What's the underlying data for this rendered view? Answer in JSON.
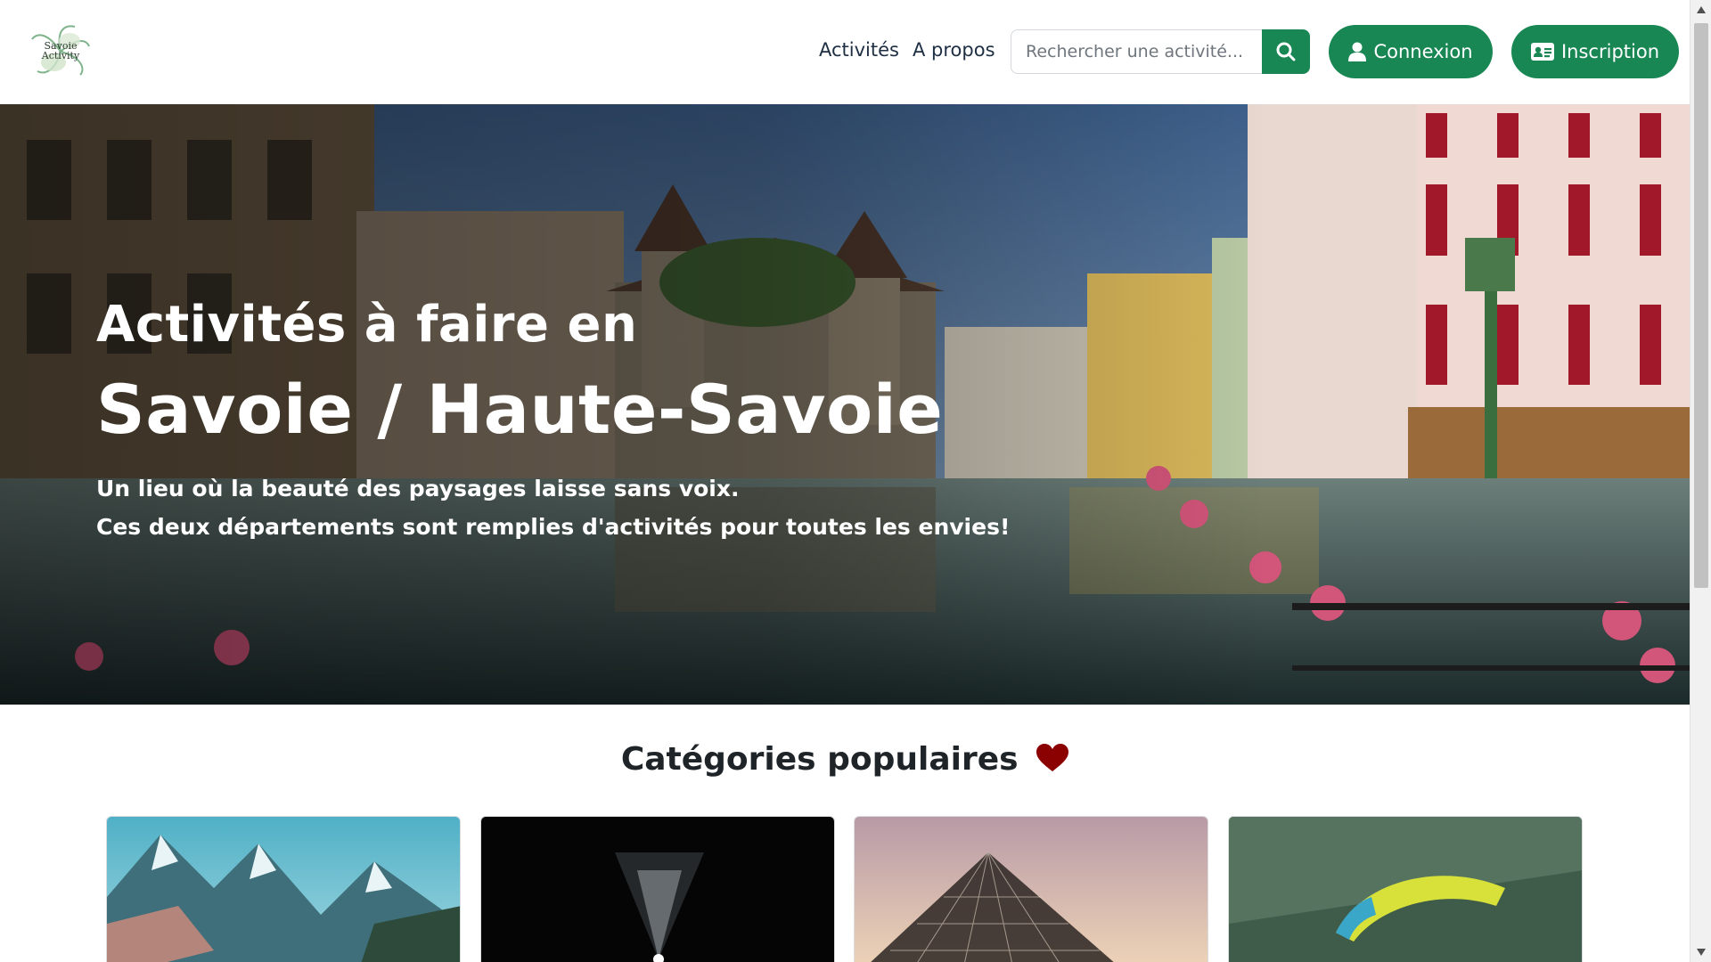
{
  "brand": {
    "logo_line1": "Savoie",
    "logo_line2": "Activity"
  },
  "nav": {
    "links": [
      "Activités",
      "A propos"
    ]
  },
  "search": {
    "placeholder": "Rechercher une activité..."
  },
  "auth": {
    "login_label": "Connexion",
    "signup_label": "Inscription"
  },
  "hero": {
    "title_line1": "Activités à faire en",
    "title_line2": "Savoie / Haute-Savoie",
    "subtitle_line1": "Un lieu où la beauté des paysages laisse sans voix.",
    "subtitle_line2": "Ces deux départements sont remplies d'activités pour toutes les envies!"
  },
  "categories": {
    "heading": "Catégories populaires"
  },
  "colors": {
    "accent_green": "#198754",
    "heart_red": "#8b0000",
    "nav_text": "#1e2f44"
  },
  "icons": {
    "search": "magnifying-glass-icon",
    "login": "user-icon",
    "signup": "id-card-icon",
    "heading": "heart-icon"
  }
}
